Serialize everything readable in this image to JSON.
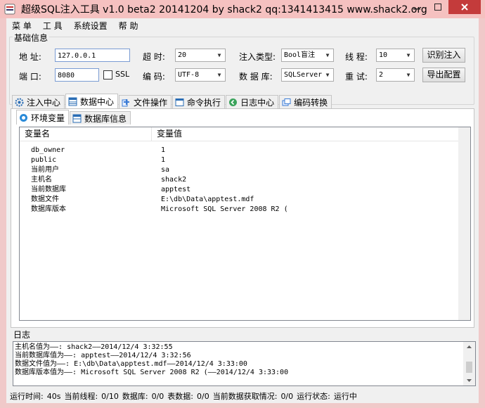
{
  "window": {
    "title": "超级SQL注入工具 v1.0 beta2 20141204 by shack2 qq:1341413415 www.shack2.org"
  },
  "menu": [
    "菜 单",
    "工 具",
    "系统设置",
    "帮 助"
  ],
  "basic": {
    "group_title": "基础信息",
    "address_label": "地 址:",
    "address_value": "127.0.0.1",
    "port_label": "端 口:",
    "port_value": "8080",
    "ssl_label": "SSL",
    "ssl_checked": false,
    "timeout_label": "超 时:",
    "timeout_value": "20",
    "encoding_label": "编 码:",
    "encoding_value": "UTF-8",
    "inject_type_label": "注入类型:",
    "inject_type_value": "Bool盲注",
    "database_label": "数 据 库:",
    "database_value": "SQLServer",
    "threads_label": "线 程:",
    "threads_value": "10",
    "retry_label": "重 试:",
    "retry_value": "2",
    "identify_button": "识别注入",
    "export_button": "导出配置"
  },
  "tabs": [
    {
      "label": "注入中心",
      "icon": "gear-icon",
      "active": false
    },
    {
      "label": "数据中心",
      "icon": "database-icon",
      "active": true
    },
    {
      "label": "文件操作",
      "icon": "file-icon",
      "active": false
    },
    {
      "label": "命令执行",
      "icon": "terminal-icon",
      "active": false
    },
    {
      "label": "日志中心",
      "icon": "log-icon",
      "active": false
    },
    {
      "label": "编码转换",
      "icon": "code-icon",
      "active": false
    }
  ],
  "subtabs": [
    {
      "label": "环境变量",
      "icon": "info-icon",
      "active": true
    },
    {
      "label": "数据库信息",
      "icon": "table-icon",
      "active": false
    }
  ],
  "env_table": {
    "columns": [
      "变量名",
      "变量值"
    ],
    "rows": [
      [
        "db_owner",
        "1"
      ],
      [
        "public",
        "1"
      ],
      [
        "当前用户",
        "sa"
      ],
      [
        "主机名",
        "shack2"
      ],
      [
        "当前数据库",
        "apptest"
      ],
      [
        "数据文件",
        "E:\\db\\Data\\apptest.mdf"
      ],
      [
        "数据库版本",
        "Microsoft SQL Server 2008 R2 ("
      ]
    ]
  },
  "log": {
    "label": "日志",
    "lines": [
      "主机名值为——: shack2——2014/12/4 3:32:55",
      "当前数据库值为——: apptest——2014/12/4 3:32:56",
      "数据文件值为——: E:\\db\\Data\\apptest.mdf——2014/12/4 3:33:00",
      "数据库版本值为——: Microsoft SQL Server 2008 R2 (——2014/12/4 3:33:00"
    ]
  },
  "status": {
    "run_time_label": "运行时间:",
    "run_time_value": "40s",
    "threads_label": "当前线程:",
    "threads_value": "0/10",
    "db_label": "数据库:",
    "db_value": "0/0",
    "tables_label": "表数据:",
    "tables_value": "0/0",
    "fetch_label": "当前数据获取情况:",
    "fetch_value": "0/0",
    "state_label": "运行状态:",
    "state_value": "运行中"
  },
  "colors": {
    "titlebar": "#f5c1c0",
    "close": "#c43b3b",
    "window_bg": "#f0f0f0"
  }
}
